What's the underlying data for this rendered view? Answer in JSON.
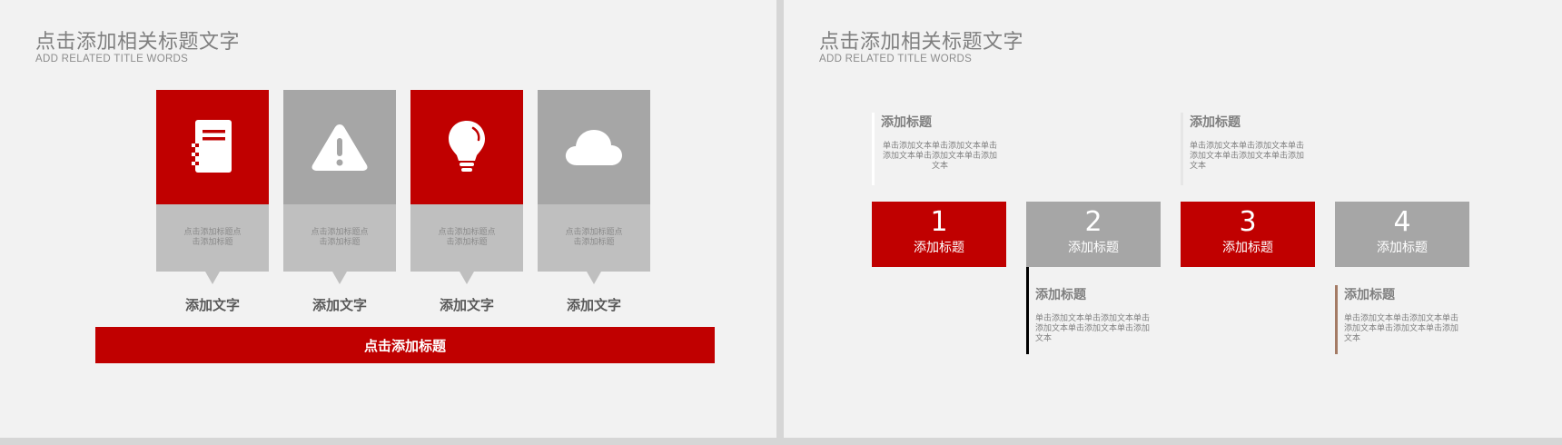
{
  "left_slide": {
    "title": "点击添加相关标题文字",
    "subtitle": "ADD RELATED TITLE WORDS",
    "cards": [
      {
        "icon": "document-icon",
        "desc": "点击添加标题点击添加标题",
        "caption": "添加文字"
      },
      {
        "icon": "warning-icon",
        "desc": "点击添加标题点击添加标题",
        "caption": "添加文字"
      },
      {
        "icon": "lightbulb-icon",
        "desc": "点击添加标题点击添加标题",
        "caption": "添加文字"
      },
      {
        "icon": "cloud-icon",
        "desc": "点击添加标题点击添加标题",
        "caption": "添加文字"
      }
    ],
    "banner": "点击添加标题"
  },
  "right_slide": {
    "title": "点击添加相关标题文字",
    "subtitle": "ADD RELATED TITLE WORDS",
    "steps": [
      {
        "number": "1",
        "label": "添加标题"
      },
      {
        "number": "2",
        "label": "添加标题"
      },
      {
        "number": "3",
        "label": "添加标题"
      },
      {
        "number": "4",
        "label": "添加标题"
      }
    ],
    "notes": [
      {
        "title": "添加标题",
        "text": "单击添加文本单击添加文本单击添加文本单击添加文本单击添加文本"
      },
      {
        "title": "添加标题",
        "text": "单击添加文本单击添加文本单击添加文本单击添加文本单击添加文本"
      },
      {
        "title": "添加标题",
        "text": "单击添加文本单击添加文本单击添加文本单击添加文本单击添加文本"
      },
      {
        "title": "添加标题",
        "text": "单击添加文本单击添加文本单击添加文本单击添加文本单击添加文本"
      }
    ]
  },
  "colors": {
    "accent": "#c00000",
    "gray": "#a6a6a6",
    "light_gray": "#bfbfbf",
    "background": "#f2f2f2"
  }
}
